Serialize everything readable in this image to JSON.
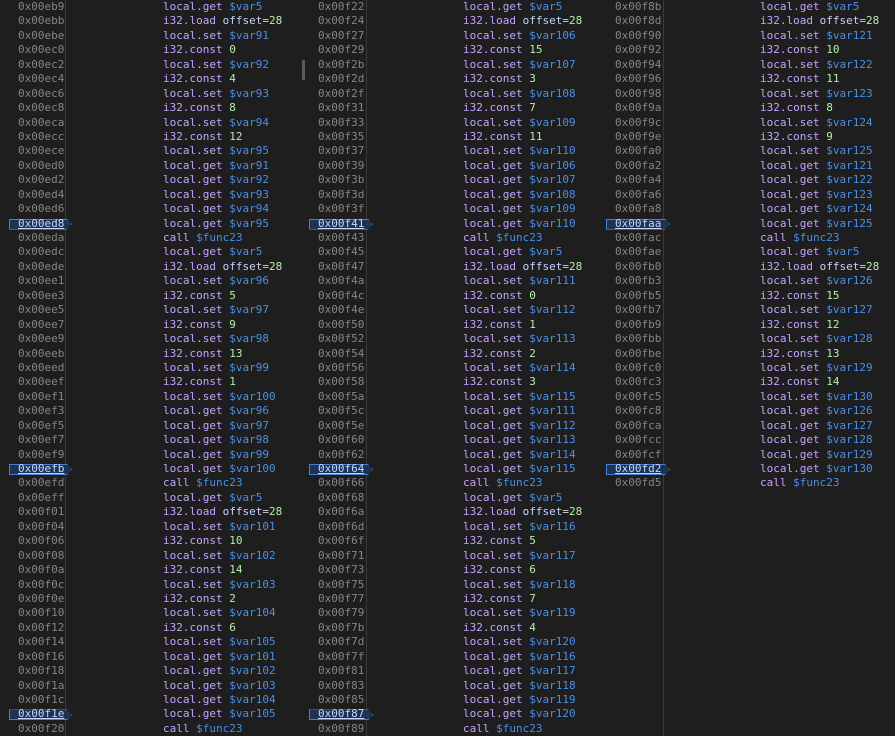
{
  "columns": [
    {
      "addresses": [
        "0x00eb9",
        "0x00ebb",
        "0x00ebe",
        "0x00ec0",
        "0x00ec2",
        "0x00ec4",
        "0x00ec6",
        "0x00ec8",
        "0x00eca",
        "0x00ecc",
        "0x00ece",
        "0x00ed0",
        "0x00ed2",
        "0x00ed4",
        "0x00ed6",
        "0x00ed8",
        "0x00eda",
        "0x00edc",
        "0x00ede",
        "0x00ee1",
        "0x00ee3",
        "0x00ee5",
        "0x00ee7",
        "0x00ee9",
        "0x00eeb",
        "0x00eed",
        "0x00eef",
        "0x00ef1",
        "0x00ef3",
        "0x00ef5",
        "0x00ef7",
        "0x00ef9",
        "0x00efb",
        "0x00efd",
        "0x00eff",
        "0x00f01",
        "0x00f04",
        "0x00f06",
        "0x00f08",
        "0x00f0a",
        "0x00f0c",
        "0x00f0e",
        "0x00f10",
        "0x00f12",
        "0x00f14",
        "0x00f16",
        "0x00f18",
        "0x00f1a",
        "0x00f1c",
        "0x00f1e",
        "0x00f20"
      ],
      "breakpoints": [
        15,
        32,
        49
      ],
      "code": [
        [
          "local.get",
          "$var5"
        ],
        [
          "i32.load",
          "offset=28"
        ],
        [
          "local.set",
          "$var91"
        ],
        [
          "i32.const",
          "0"
        ],
        [
          "local.set",
          "$var92"
        ],
        [
          "i32.const",
          "4"
        ],
        [
          "local.set",
          "$var93"
        ],
        [
          "i32.const",
          "8"
        ],
        [
          "local.set",
          "$var94"
        ],
        [
          "i32.const",
          "12"
        ],
        [
          "local.set",
          "$var95"
        ],
        [
          "local.get",
          "$var91"
        ],
        [
          "local.get",
          "$var92"
        ],
        [
          "local.get",
          "$var93"
        ],
        [
          "local.get",
          "$var94"
        ],
        [
          "local.get",
          "$var95"
        ],
        [
          "call",
          "$func23"
        ],
        [
          "local.get",
          "$var5"
        ],
        [
          "i32.load",
          "offset=28"
        ],
        [
          "local.set",
          "$var96"
        ],
        [
          "i32.const",
          "5"
        ],
        [
          "local.set",
          "$var97"
        ],
        [
          "i32.const",
          "9"
        ],
        [
          "local.set",
          "$var98"
        ],
        [
          "i32.const",
          "13"
        ],
        [
          "local.set",
          "$var99"
        ],
        [
          "i32.const",
          "1"
        ],
        [
          "local.set",
          "$var100"
        ],
        [
          "local.get",
          "$var96"
        ],
        [
          "local.get",
          "$var97"
        ],
        [
          "local.get",
          "$var98"
        ],
        [
          "local.get",
          "$var99"
        ],
        [
          "local.get",
          "$var100"
        ],
        [
          "call",
          "$func23"
        ],
        [
          "local.get",
          "$var5"
        ],
        [
          "i32.load",
          "offset=28"
        ],
        [
          "local.set",
          "$var101"
        ],
        [
          "i32.const",
          "10"
        ],
        [
          "local.set",
          "$var102"
        ],
        [
          "i32.const",
          "14"
        ],
        [
          "local.set",
          "$var103"
        ],
        [
          "i32.const",
          "2"
        ],
        [
          "local.set",
          "$var104"
        ],
        [
          "i32.const",
          "6"
        ],
        [
          "local.set",
          "$var105"
        ],
        [
          "local.get",
          "$var101"
        ],
        [
          "local.get",
          "$var102"
        ],
        [
          "local.get",
          "$var103"
        ],
        [
          "local.get",
          "$var104"
        ],
        [
          "local.get",
          "$var105"
        ],
        [
          "call",
          "$func23"
        ]
      ]
    },
    {
      "addresses": [
        "0x00f22",
        "0x00f24",
        "0x00f27",
        "0x00f29",
        "0x00f2b",
        "0x00f2d",
        "0x00f2f",
        "0x00f31",
        "0x00f33",
        "0x00f35",
        "0x00f37",
        "0x00f39",
        "0x00f3b",
        "0x00f3d",
        "0x00f3f",
        "0x00f41",
        "0x00f43",
        "0x00f45",
        "0x00f47",
        "0x00f4a",
        "0x00f4c",
        "0x00f4e",
        "0x00f50",
        "0x00f52",
        "0x00f54",
        "0x00f56",
        "0x00f58",
        "0x00f5a",
        "0x00f5c",
        "0x00f5e",
        "0x00f60",
        "0x00f62",
        "0x00f64",
        "0x00f66",
        "0x00f68",
        "0x00f6a",
        "0x00f6d",
        "0x00f6f",
        "0x00f71",
        "0x00f73",
        "0x00f75",
        "0x00f77",
        "0x00f79",
        "0x00f7b",
        "0x00f7d",
        "0x00f7f",
        "0x00f81",
        "0x00f83",
        "0x00f85",
        "0x00f87",
        "0x00f89"
      ],
      "breakpoints": [
        15,
        32,
        49
      ],
      "code": [
        [
          "local.get",
          "$var5"
        ],
        [
          "i32.load",
          "offset=28"
        ],
        [
          "local.set",
          "$var106"
        ],
        [
          "i32.const",
          "15"
        ],
        [
          "local.set",
          "$var107"
        ],
        [
          "i32.const",
          "3"
        ],
        [
          "local.set",
          "$var108"
        ],
        [
          "i32.const",
          "7"
        ],
        [
          "local.set",
          "$var109"
        ],
        [
          "i32.const",
          "11"
        ],
        [
          "local.set",
          "$var110"
        ],
        [
          "local.get",
          "$var106"
        ],
        [
          "local.get",
          "$var107"
        ],
        [
          "local.get",
          "$var108"
        ],
        [
          "local.get",
          "$var109"
        ],
        [
          "local.get",
          "$var110"
        ],
        [
          "call",
          "$func23"
        ],
        [
          "local.get",
          "$var5"
        ],
        [
          "i32.load",
          "offset=28"
        ],
        [
          "local.set",
          "$var111"
        ],
        [
          "i32.const",
          "0"
        ],
        [
          "local.set",
          "$var112"
        ],
        [
          "i32.const",
          "1"
        ],
        [
          "local.set",
          "$var113"
        ],
        [
          "i32.const",
          "2"
        ],
        [
          "local.set",
          "$var114"
        ],
        [
          "i32.const",
          "3"
        ],
        [
          "local.set",
          "$var115"
        ],
        [
          "local.get",
          "$var111"
        ],
        [
          "local.get",
          "$var112"
        ],
        [
          "local.get",
          "$var113"
        ],
        [
          "local.get",
          "$var114"
        ],
        [
          "local.get",
          "$var115"
        ],
        [
          "call",
          "$func23"
        ],
        [
          "local.get",
          "$var5"
        ],
        [
          "i32.load",
          "offset=28"
        ],
        [
          "local.set",
          "$var116"
        ],
        [
          "i32.const",
          "5"
        ],
        [
          "local.set",
          "$var117"
        ],
        [
          "i32.const",
          "6"
        ],
        [
          "local.set",
          "$var118"
        ],
        [
          "i32.const",
          "7"
        ],
        [
          "local.set",
          "$var119"
        ],
        [
          "i32.const",
          "4"
        ],
        [
          "local.set",
          "$var120"
        ],
        [
          "local.get",
          "$var116"
        ],
        [
          "local.get",
          "$var117"
        ],
        [
          "local.get",
          "$var118"
        ],
        [
          "local.get",
          "$var119"
        ],
        [
          "local.get",
          "$var120"
        ],
        [
          "call",
          "$func23"
        ]
      ]
    },
    {
      "addresses": [
        "0x00f8b",
        "0x00f8d",
        "0x00f90",
        "0x00f92",
        "0x00f94",
        "0x00f96",
        "0x00f98",
        "0x00f9a",
        "0x00f9c",
        "0x00f9e",
        "0x00fa0",
        "0x00fa2",
        "0x00fa4",
        "0x00fa6",
        "0x00fa8",
        "0x00faa",
        "0x00fac",
        "0x00fae",
        "0x00fb0",
        "0x00fb3",
        "0x00fb5",
        "0x00fb7",
        "0x00fb9",
        "0x00fbb",
        "0x00fbe",
        "0x00fc0",
        "0x00fc3",
        "0x00fc5",
        "0x00fc8",
        "0x00fca",
        "0x00fcc",
        "0x00fcf",
        "0x00fd2",
        "0x00fd5"
      ],
      "breakpoints": [
        15,
        32
      ],
      "code": [
        [
          "local.get",
          "$var5"
        ],
        [
          "i32.load",
          "offset=28"
        ],
        [
          "local.set",
          "$var121"
        ],
        [
          "i32.const",
          "10"
        ],
        [
          "local.set",
          "$var122"
        ],
        [
          "i32.const",
          "11"
        ],
        [
          "local.set",
          "$var123"
        ],
        [
          "i32.const",
          "8"
        ],
        [
          "local.set",
          "$var124"
        ],
        [
          "i32.const",
          "9"
        ],
        [
          "local.set",
          "$var125"
        ],
        [
          "local.get",
          "$var121"
        ],
        [
          "local.get",
          "$var122"
        ],
        [
          "local.get",
          "$var123"
        ],
        [
          "local.get",
          "$var124"
        ],
        [
          "local.get",
          "$var125"
        ],
        [
          "call",
          "$func23"
        ],
        [
          "local.get",
          "$var5"
        ],
        [
          "i32.load",
          "offset=28"
        ],
        [
          "local.set",
          "$var126"
        ],
        [
          "i32.const",
          "15"
        ],
        [
          "local.set",
          "$var127"
        ],
        [
          "i32.const",
          "12"
        ],
        [
          "local.set",
          "$var128"
        ],
        [
          "i32.const",
          "13"
        ],
        [
          "local.set",
          "$var129"
        ],
        [
          "i32.const",
          "14"
        ],
        [
          "local.set",
          "$var130"
        ],
        [
          "local.get",
          "$var126"
        ],
        [
          "local.get",
          "$var127"
        ],
        [
          "local.get",
          "$var128"
        ],
        [
          "local.get",
          "$var129"
        ],
        [
          "local.get",
          "$var130"
        ],
        [
          "call",
          "$func23"
        ]
      ]
    }
  ]
}
